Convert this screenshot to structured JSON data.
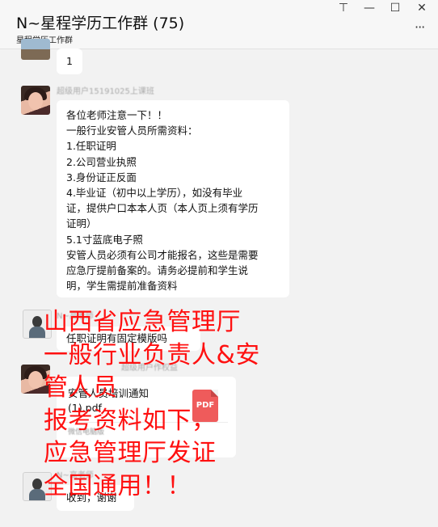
{
  "window": {
    "title": "N~星程学历工作群 (75)",
    "subtitle": "星程学历工作群",
    "controls": [
      "⊤",
      "—",
      "☐",
      "✕"
    ],
    "more_label": "···"
  },
  "messages": {
    "first_reply": "1",
    "sender_blurred_1": "超级用户15191025上课班",
    "notice_lines": [
      "各位老师注意一下！！",
      "一般行业安管人员所需资料：",
      "1.任职证明",
      "2.公司营业执照",
      "3.身份证正反面",
      "4.毕业证（初中以上学历），如没有毕业",
      "证，提供户口本本人页（本人页上须有学历",
      "证明）",
      "5.1寸蓝底电子照",
      "安管人员必须有公司才能报名，这些是需要",
      "应急厅提前备案的。请务必提前和学生说",
      "明，学生需提前准备资料"
    ],
    "sender_2": "N~高老师",
    "question": "任职证明有固定模版吗",
    "sender_blurred_3": "超级用户作权益",
    "file": {
      "name_line1": "安管人员培训通知",
      "name_line2": "(1).pdf",
      "icon_label": "PDF",
      "source": "微信电脑版"
    },
    "sender_4": "N~高老师",
    "last_reply": "收到，谢谢"
  },
  "overlay_text": [
    "山西省应急管理厅",
    "一般行业负责人&安",
    "管人员",
    "报考资料如下，",
    "应急管理厅发证",
    "全国通用！！"
  ],
  "colors": {
    "overlay": "#ff1010",
    "pdf_icon": "#ef5b5b",
    "bubble": "#ffffff",
    "background": "#f2f2f2"
  }
}
